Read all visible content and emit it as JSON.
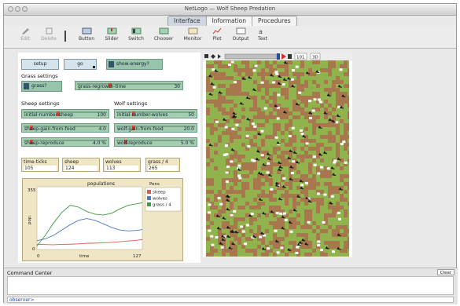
{
  "window": {
    "title": "NetLogo — Wolf Sheep Predation"
  },
  "tabs": [
    {
      "label": "Interface",
      "active": true
    },
    {
      "label": "Information",
      "active": false
    },
    {
      "label": "Procedures",
      "active": false
    }
  ],
  "toolbar": {
    "items": [
      {
        "label": "Edit",
        "icon": "pencil-icon",
        "enabled": false
      },
      {
        "label": "Delete",
        "icon": "delete-icon",
        "enabled": false
      },
      {
        "label": "Button",
        "icon": "button-widget-icon",
        "enabled": true
      },
      {
        "label": "Slider",
        "icon": "slider-widget-icon",
        "enabled": true
      },
      {
        "label": "Switch",
        "icon": "switch-widget-icon",
        "enabled": true
      },
      {
        "label": "Chooser",
        "icon": "chooser-widget-icon",
        "enabled": true
      },
      {
        "label": "Monitor",
        "icon": "monitor-widget-icon",
        "enabled": true
      },
      {
        "label": "Plot",
        "icon": "plot-widget-icon",
        "enabled": true
      },
      {
        "label": "Output",
        "icon": "output-widget-icon",
        "enabled": true
      },
      {
        "label": "Text",
        "icon": "text-widget-icon",
        "enabled": true
      }
    ]
  },
  "buttons": {
    "setup": "setup",
    "go": "go"
  },
  "switches": {
    "show_energy": {
      "label": "show-energy?",
      "state": "Off"
    },
    "grass": {
      "label": "grass?",
      "state": "Off"
    }
  },
  "switch_on_text": "On",
  "sections": {
    "grass": "Grass settings",
    "sheep": "Sheep settings",
    "wolf": "Wolf settings"
  },
  "sliders": {
    "grass_regrowth_time": {
      "label": "grass-regrowth-time",
      "value": "30",
      "fraction": 0.3
    },
    "initial_number_sheep": {
      "label": "initial-number-sheep",
      "value": "100",
      "fraction": 0.4
    },
    "sheep_gain_from_food": {
      "label": "sheep-gain-from-food",
      "value": "4.0",
      "fraction": 0.08
    },
    "sheep_reproduce": {
      "label": "sheep-reproduce",
      "value": "4.0 %",
      "fraction": 0.08
    },
    "initial_number_wolves": {
      "label": "initial-number-wolves",
      "value": "50",
      "fraction": 0.2
    },
    "wolf_gain_from_food": {
      "label": "wolf-gain-from-food",
      "value": "20.0",
      "fraction": 0.2
    },
    "wolf_reproduce": {
      "label": "wolf-reproduce",
      "value": "5.0 %",
      "fraction": 0.1
    }
  },
  "monitors": [
    {
      "label": "time-ticks",
      "value": "105"
    },
    {
      "label": "sheep",
      "value": "124"
    },
    {
      "label": "wolves",
      "value": "113"
    },
    {
      "label": "grass / 4",
      "value": "265"
    }
  ],
  "plot": {
    "title": "populations",
    "ylabel": "pop.",
    "xlabel": "time",
    "ymax": "355",
    "ymin": "0",
    "xmin": "0",
    "xmax": "127",
    "pens_title": "Pens",
    "pens": [
      {
        "name": "sheep",
        "color": "#e05a4f"
      },
      {
        "name": "wolves",
        "color": "#4b78c8"
      },
      {
        "name": "grass / 4",
        "color": "#3f9b3f"
      }
    ]
  },
  "view": {
    "speed_box": "101",
    "view_3d_label": "3D",
    "colors": {
      "grass": "#91b34d",
      "dirt": "#a9774d",
      "sheep": "#ffffff",
      "wolf": "#1a1a1a"
    }
  },
  "command_center": {
    "title": "Command Center",
    "clear_label": "Clear",
    "agent_selector": "observer>",
    "input_value": ""
  },
  "chart_data": {
    "type": "line",
    "title": "populations",
    "xlabel": "time",
    "ylabel": "pop.",
    "xlim": [
      0,
      127
    ],
    "ylim": [
      0,
      355
    ],
    "series": [
      {
        "name": "sheep",
        "color": "#e05a4f",
        "x": [
          0,
          10,
          20,
          30,
          40,
          50,
          60,
          70,
          80,
          90,
          100,
          110,
          120,
          127
        ],
        "values": [
          30,
          28,
          27,
          29,
          30,
          32,
          35,
          36,
          38,
          40,
          44,
          48,
          52,
          56
        ]
      },
      {
        "name": "wolves",
        "color": "#4b78c8",
        "x": [
          0,
          10,
          20,
          30,
          40,
          50,
          60,
          70,
          80,
          90,
          100,
          110,
          120,
          127
        ],
        "values": [
          50,
          60,
          80,
          110,
          140,
          165,
          175,
          165,
          145,
          125,
          110,
          105,
          108,
          113
        ]
      },
      {
        "name": "grass / 4",
        "color": "#3f9b3f",
        "x": [
          0,
          10,
          20,
          30,
          40,
          50,
          60,
          70,
          80,
          90,
          100,
          110,
          120,
          127
        ],
        "values": [
          20,
          80,
          150,
          210,
          250,
          240,
          215,
          200,
          195,
          205,
          230,
          250,
          258,
          265
        ]
      }
    ]
  }
}
